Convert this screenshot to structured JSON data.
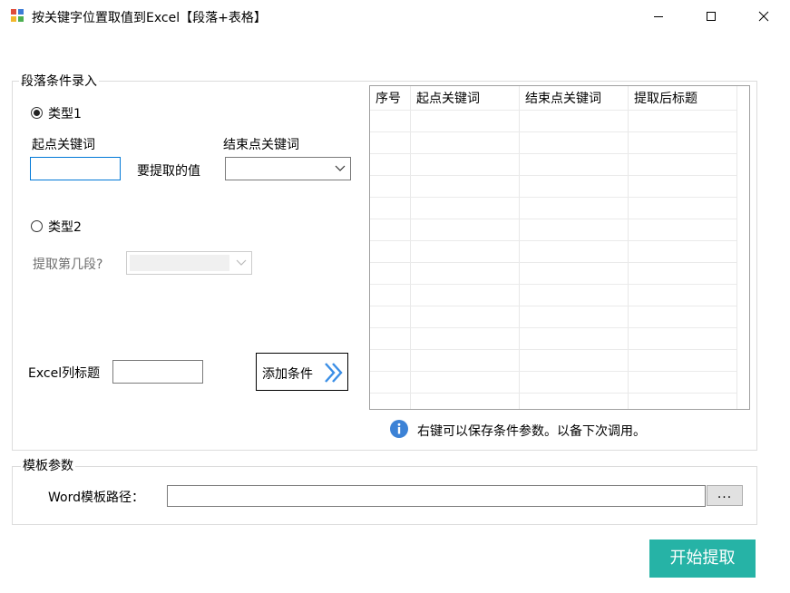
{
  "window": {
    "title": "按关键字位置取值到Excel【段落+表格】",
    "icon": "app-icon",
    "controls": [
      "minimize-icon",
      "maximize-icon",
      "close-icon"
    ]
  },
  "paragraph_group": {
    "legend": "段落条件录入",
    "type1": {
      "label": "类型1",
      "checked": true
    },
    "start_keyword_label": "起点关键词",
    "start_keyword_value": "",
    "extract_value_label": "要提取的值",
    "end_keyword_label": "结束点关键词",
    "end_keyword_value": "",
    "type2": {
      "label": "类型2",
      "checked": false
    },
    "paragraph_no_label": "提取第几段?",
    "paragraph_no_value": "",
    "excel_col_label": "Excel列标题",
    "excel_col_value": "",
    "add_button_label": "添加条件"
  },
  "grid": {
    "columns": [
      "序号",
      "起点关键词",
      "结束点关键词",
      "提取后标题"
    ],
    "rows": []
  },
  "info": {
    "icon": "info-icon",
    "text": "右键可以保存条件参数。以备下次调用。"
  },
  "template_group": {
    "legend": "模板参数",
    "word_path_label": "Word模板路径：",
    "word_path_value": "",
    "browse_label": "..."
  },
  "start_button_label": "开始提取",
  "colors": {
    "accent": "#26b3a6",
    "focus_border": "#0078d7",
    "arrow_blue": "#3a8ee6",
    "info_blue": "#3c82d6"
  }
}
